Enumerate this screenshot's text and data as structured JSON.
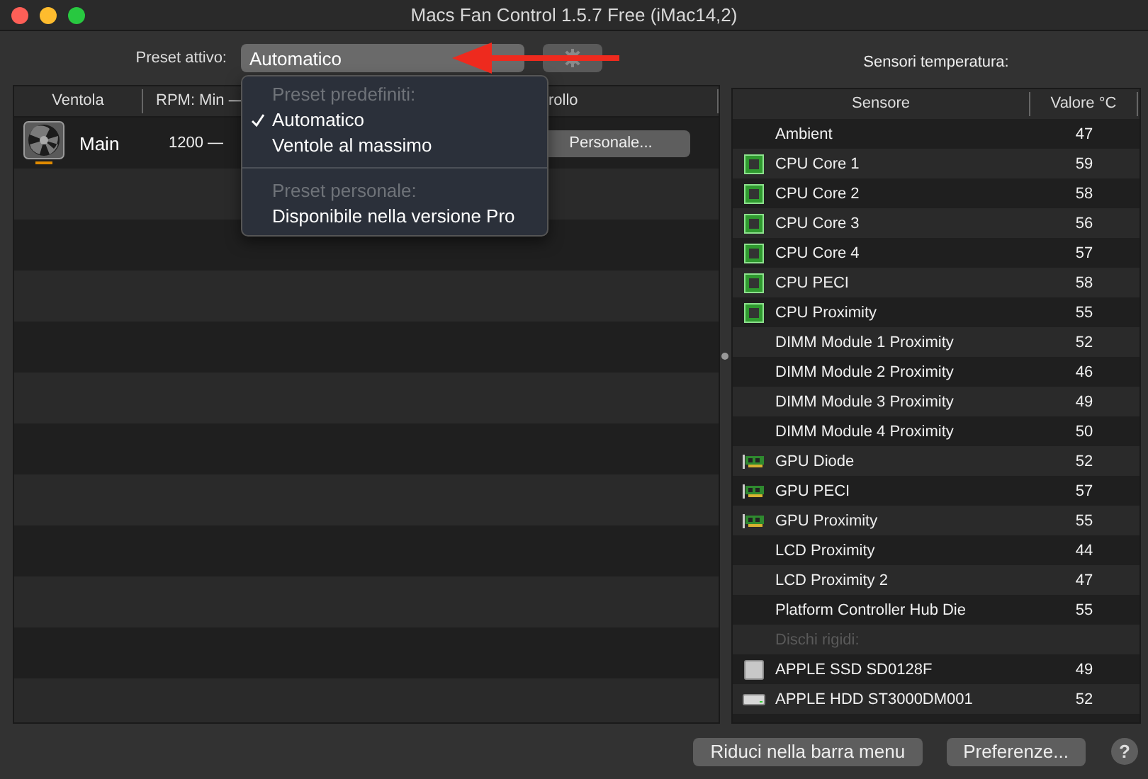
{
  "window": {
    "title": "Macs Fan Control 1.5.7 Free (iMac14,2)"
  },
  "preset": {
    "label": "Preset attivo:",
    "value": "Automatico",
    "settings_disabled": true
  },
  "preset_menu": {
    "sections": [
      {
        "header": "Preset predefiniti:",
        "items": [
          {
            "label": "Automatico",
            "checked": true
          },
          {
            "label": "Ventole al massimo",
            "checked": false
          }
        ]
      },
      {
        "header": "Preset personale:",
        "items": [
          {
            "label": "Disponibile nella versione Pro",
            "checked": false
          }
        ]
      }
    ]
  },
  "fans": {
    "columns": [
      "Ventola",
      "RPM: Min —",
      "rollo"
    ],
    "rows": [
      {
        "name": "Main",
        "rpm": "1200 —",
        "control": "Personale..."
      }
    ]
  },
  "sensors": {
    "title": "Sensori temperatura:",
    "columns": [
      "Sensore",
      "Valore °C"
    ],
    "rows": [
      {
        "kind": "plain",
        "name": "Ambient",
        "value": "47"
      },
      {
        "kind": "cpu",
        "name": "CPU Core 1",
        "value": "59"
      },
      {
        "kind": "cpu",
        "name": "CPU Core 2",
        "value": "58"
      },
      {
        "kind": "cpu",
        "name": "CPU Core 3",
        "value": "56"
      },
      {
        "kind": "cpu",
        "name": "CPU Core 4",
        "value": "57"
      },
      {
        "kind": "cpu",
        "name": "CPU PECI",
        "value": "58"
      },
      {
        "kind": "cpu",
        "name": "CPU Proximity",
        "value": "55"
      },
      {
        "kind": "plain",
        "name": "DIMM Module 1 Proximity",
        "value": "52"
      },
      {
        "kind": "plain",
        "name": "DIMM Module 2 Proximity",
        "value": "46"
      },
      {
        "kind": "plain",
        "name": "DIMM Module 3 Proximity",
        "value": "49"
      },
      {
        "kind": "plain",
        "name": "DIMM Module 4 Proximity",
        "value": "50"
      },
      {
        "kind": "gpu",
        "name": "GPU Diode",
        "value": "52"
      },
      {
        "kind": "gpu",
        "name": "GPU PECI",
        "value": "57"
      },
      {
        "kind": "gpu",
        "name": "GPU Proximity",
        "value": "55"
      },
      {
        "kind": "plain",
        "name": "LCD Proximity",
        "value": "44"
      },
      {
        "kind": "plain",
        "name": "LCD Proximity 2",
        "value": "47"
      },
      {
        "kind": "plain",
        "name": "Platform Controller Hub Die",
        "value": "55"
      },
      {
        "kind": "section",
        "name": "Dischi rigidi:"
      },
      {
        "kind": "ssd",
        "name": "APPLE SSD SD0128F",
        "value": "49"
      },
      {
        "kind": "hdd",
        "name": "APPLE HDD ST3000DM001",
        "value": "52"
      }
    ]
  },
  "buttons": [
    "Riduci nella barra menu",
    "Preferenze..."
  ],
  "help": "?"
}
